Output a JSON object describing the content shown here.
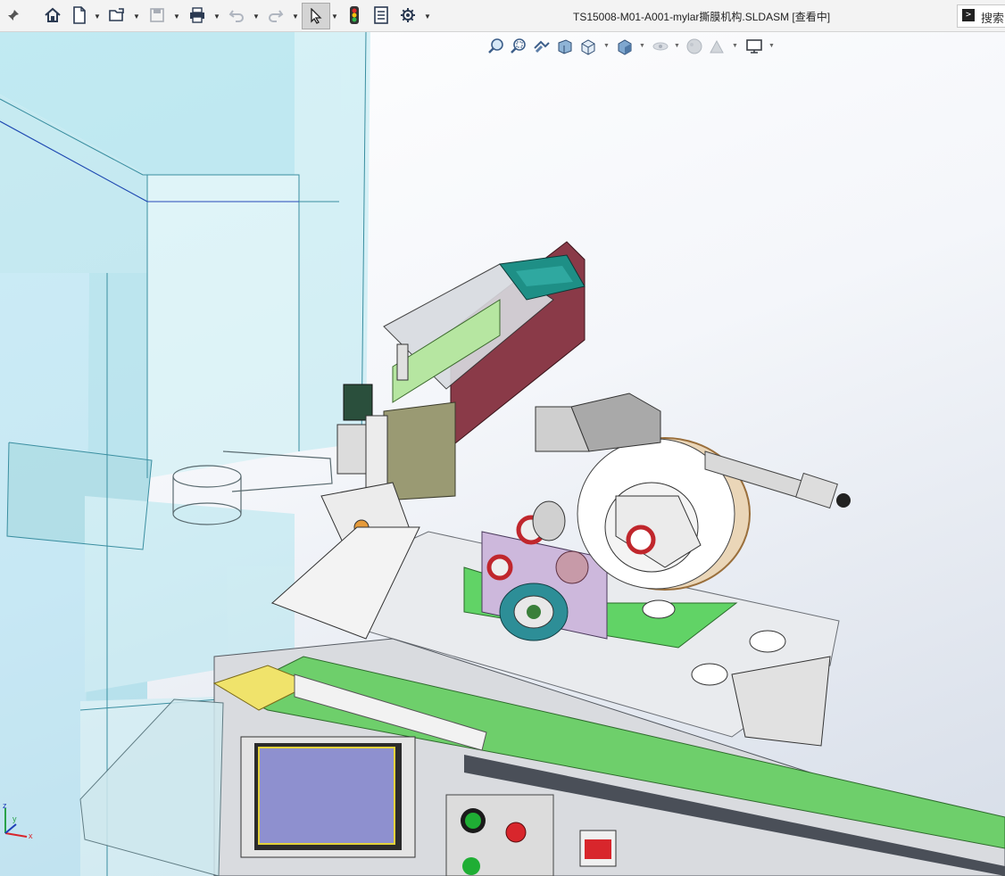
{
  "window": {
    "title": "TS15008-M01-A001-mylar撕膜机构.SLDASM [查看中]",
    "search_label": "搜索"
  },
  "toolbar": {
    "pin": "pin-icon",
    "items": [
      "home-icon",
      "new-document-icon",
      "open-icon",
      "save-icon",
      "print-icon",
      "undo-icon",
      "redo-icon",
      "select-icon",
      "rebuild-icon",
      "file-properties-icon",
      "options-icon"
    ]
  },
  "viewport_toolbar": {
    "items": [
      "zoom-to-fit-icon",
      "zoom-to-area-icon",
      "previous-view-icon",
      "section-view-icon",
      "view-orientation-icon",
      "display-style-icon",
      "hide-show-items-icon",
      "edit-appearance-icon",
      "apply-scene-icon",
      "view-settings-icon"
    ]
  },
  "triad": {
    "x": "x",
    "y": "y",
    "z": "z"
  },
  "colors": {
    "machine_green": "#5fd86a",
    "glass_cyan": "#a6e4ee",
    "frame_maroon": "#8a3a48",
    "display_blue": "#8e90cf",
    "button_red": "#d8262c",
    "button_green": "#1fae34"
  }
}
